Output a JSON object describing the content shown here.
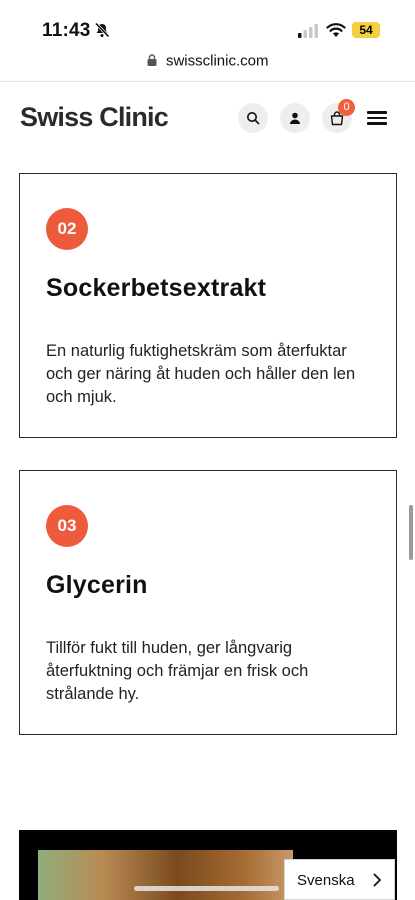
{
  "status_bar": {
    "time": "11:43",
    "battery": "54"
  },
  "browser": {
    "url": "swissclinic.com"
  },
  "header": {
    "logo": "Swiss Clinic",
    "cart_count": "0"
  },
  "ingredients": [
    {
      "number": "02",
      "title": "Sockerbetsextrakt",
      "description": "En naturlig fuktighetskräm som återfuktar och ger näring åt huden och håller den len och mjuk."
    },
    {
      "number": "03",
      "title": "Glycerin",
      "description": "Tillför fukt till huden, ger långvarig återfuktning och främjar en frisk och strålande hy."
    }
  ],
  "language_selector": {
    "label": "Svenska"
  },
  "colors": {
    "accent": "#ee5a3c",
    "badge": "#f0603d",
    "battery": "#f4d03f"
  }
}
